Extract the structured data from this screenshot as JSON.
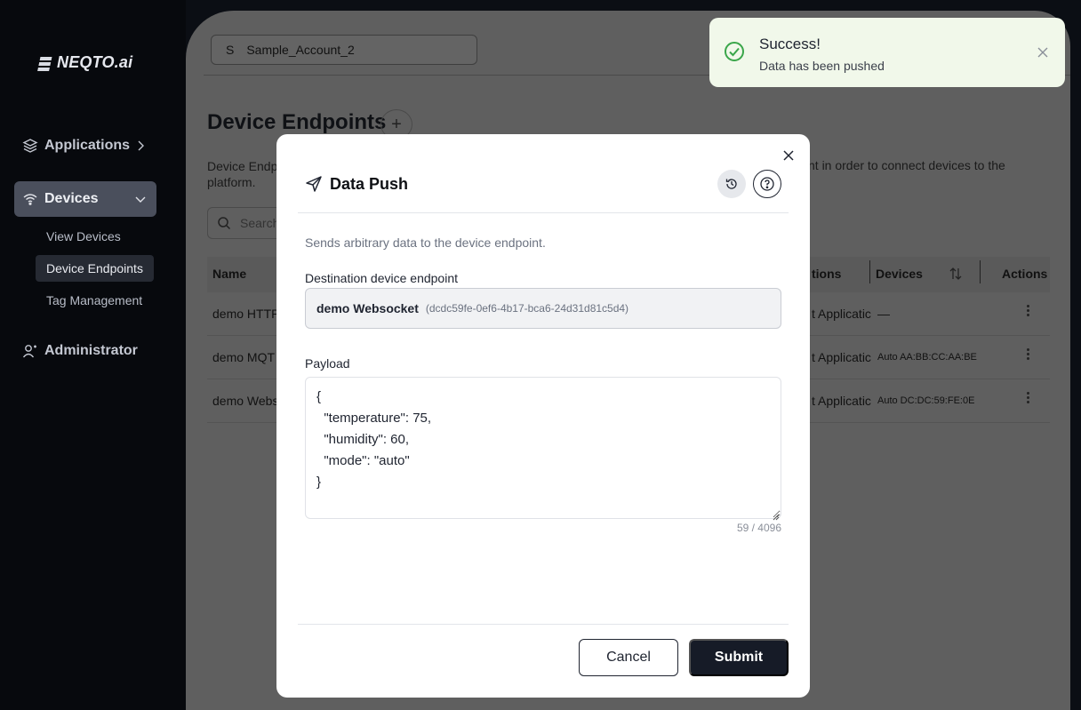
{
  "app": {
    "logo_text": "NEQTO.ai"
  },
  "sidebar": {
    "items": [
      {
        "label": "Applications"
      },
      {
        "label": "Devices"
      },
      {
        "label": "Administrator"
      }
    ],
    "sub_items": [
      {
        "label": "View Devices"
      },
      {
        "label": "Device Endpoints"
      },
      {
        "label": "Tag Management"
      }
    ]
  },
  "header": {
    "account_letter": "S",
    "account_name": "Sample_Account_2"
  },
  "page": {
    "title": "Device Endpoints",
    "add_label": "+",
    "description_left": "Device Endp",
    "description_left_2": "platform.",
    "description_right": "nt in order to connect devices to the",
    "search_placeholder": "Search"
  },
  "table": {
    "headers": {
      "name": "Name",
      "applications": "tions",
      "devices": "Devices",
      "actions": "Actions"
    },
    "rows": [
      {
        "name": "demo HTTP",
        "application": "t Applicatic",
        "devices": "—"
      },
      {
        "name": "demo MQT",
        "application": "t Applicatic",
        "devices": "Auto AA:BB:CC:AA:BE"
      },
      {
        "name": "demo Webs",
        "application": "t Applicatic",
        "devices": "Auto DC:DC:59:FE:0E"
      }
    ]
  },
  "toast": {
    "title": "Success!",
    "message": "Data has been pushed",
    "status_color": "#3aa64a"
  },
  "modal": {
    "title": "Data Push",
    "description": "Sends arbitrary data to the device endpoint.",
    "destination_label": "Destination device endpoint",
    "destination_name": "demo Websocket",
    "destination_id": "(dcdc59fe-0ef6-4b17-bca6-24d31d81c5d4)",
    "payload_label": "Payload",
    "payload_value": "{\n  \"temperature\": 75,\n  \"humidity\": 60,\n  \"mode\": \"auto\"\n}",
    "counter": "59 / 4096",
    "cancel_label": "Cancel",
    "submit_label": "Submit"
  }
}
